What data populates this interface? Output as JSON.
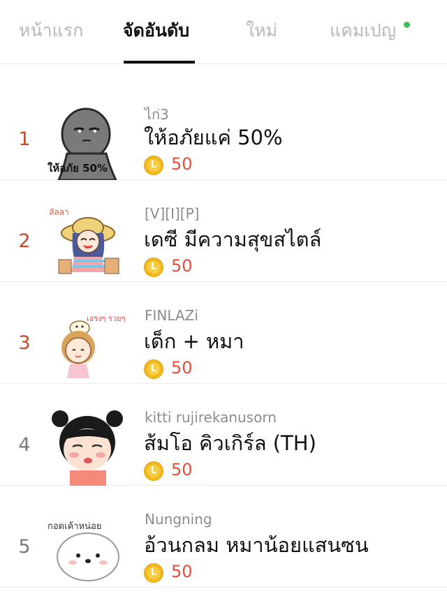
{
  "tabs": [
    {
      "label": "หน้าแรก",
      "active": false
    },
    {
      "label": "จัดอันดับ",
      "active": true
    },
    {
      "label": "ใหม่",
      "active": false
    },
    {
      "label": "แคมเปญ",
      "active": false,
      "has_dot": true
    }
  ],
  "colors": {
    "accent_red": "#e84c3d",
    "rank_red": "#c44a2c",
    "coin_gold": "#f3b81d",
    "dot_green": "#3fbf5a"
  },
  "items": [
    {
      "rank": "1",
      "author": "ไก่3",
      "title": "ให้อภัยแค่ 50%",
      "price": "50",
      "icon": "coin-icon",
      "sticker_caption": "ให้อภัย 50%"
    },
    {
      "rank": "2",
      "author": "[V][I][P]",
      "title": "เดซี มีความสุขสไตล์",
      "price": "50",
      "icon": "coin-icon",
      "sticker_caption": "ลัลลา"
    },
    {
      "rank": "3",
      "author": "FINLAZi",
      "title": "เด็ก + หมา",
      "price": "50",
      "icon": "coin-icon",
      "sticker_caption": "เอรงๆ รวยๆ ค้าบ"
    },
    {
      "rank": "4",
      "author": "kitti rujirekanusorn",
      "title": "ส้มโอ คิวเกิร์ล (TH)",
      "price": "50",
      "icon": "coin-icon",
      "sticker_caption": ""
    },
    {
      "rank": "5",
      "author": "Nungning",
      "title": "อ้วนกลม หมาน้อยแสนซน",
      "price": "50",
      "icon": "coin-icon",
      "sticker_caption": "กอดเค้าหน่อย"
    }
  ]
}
